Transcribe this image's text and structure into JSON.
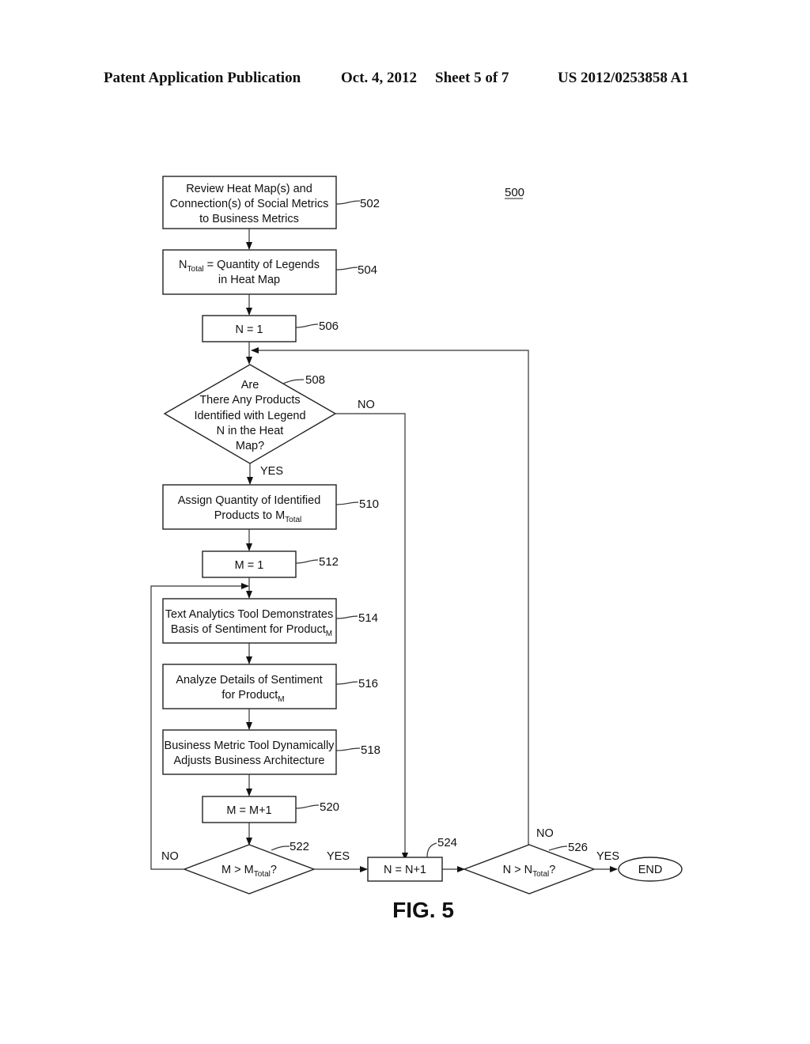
{
  "header": {
    "left": "Patent Application Publication",
    "date": "Oct. 4, 2012",
    "sheet": "Sheet 5 of 7",
    "number": "US 2012/0253858 A1"
  },
  "figure": {
    "ref": "500",
    "caption": "FIG. 5"
  },
  "nodes": {
    "n502": {
      "ref": "502",
      "lines": [
        "Review Heat Map(s) and",
        "Connection(s) of Social Metrics",
        "to Business Metrics"
      ]
    },
    "n504": {
      "ref": "504",
      "l1_pre": "N",
      "l1_sub": "Total",
      "l1_post": " = Quantity of Legends",
      "l2": "in Heat Map"
    },
    "n506": {
      "ref": "506",
      "text": "N = 1"
    },
    "n508": {
      "ref": "508",
      "lines": [
        "Are",
        "There Any Products",
        "Identified with Legend",
        "N in the Heat",
        "Map?"
      ]
    },
    "n510": {
      "ref": "510",
      "l1": "Assign Quantity of Identified",
      "l2_pre": "Products to M",
      "l2_sub": "Total"
    },
    "n512": {
      "ref": "512",
      "text": "M = 1"
    },
    "n514": {
      "ref": "514",
      "l1": "Text Analytics Tool Demonstrates",
      "l2_pre": "Basis of Sentiment for Product",
      "l2_sub": "M"
    },
    "n516": {
      "ref": "516",
      "l1": "Analyze Details of Sentiment",
      "l2_pre": "for Product",
      "l2_sub": "M"
    },
    "n518": {
      "ref": "518",
      "lines": [
        "Business Metric Tool Dynamically",
        "Adjusts Business Architecture"
      ]
    },
    "n520": {
      "ref": "520",
      "text": "M = M+1"
    },
    "n522": {
      "ref": "522",
      "pre": "M > M",
      "sub": "Total",
      "post": "?"
    },
    "n524": {
      "ref": "524",
      "text": "N = N+1"
    },
    "n526": {
      "ref": "526",
      "pre": "N > N",
      "sub": "Total",
      "post": "?"
    },
    "end": {
      "text": "END"
    }
  },
  "edge_labels": {
    "e508_no": "NO",
    "e508_yes": "YES",
    "e522_no": "NO",
    "e522_yes": "YES",
    "e526_no": "NO",
    "e526_yes": "YES"
  }
}
